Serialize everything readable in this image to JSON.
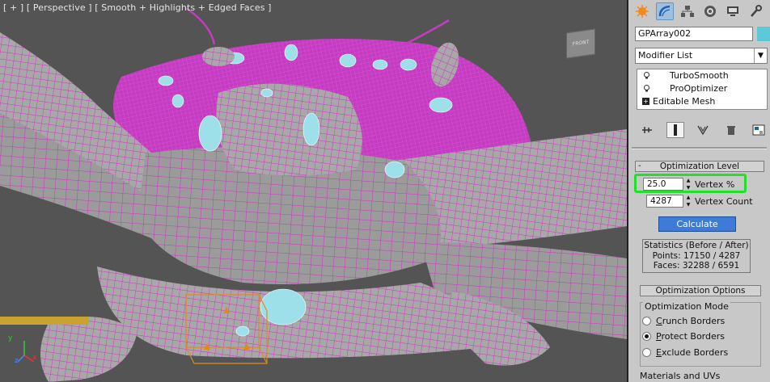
{
  "viewport": {
    "label": "[ + ] [ Perspective ] [ Smooth + Highlights + Edged Faces ]",
    "viewcube_label": "FRONT",
    "axis": {
      "x": "x",
      "y": "y",
      "z": "z"
    },
    "colors": {
      "wireframe": "#d92ad0",
      "mesh": "#9a9a9a",
      "background": "#545454",
      "selection_box": "#e08a1a",
      "ice": "#9ee0ea"
    }
  },
  "toolbar": {
    "tabs": [
      "create-icon",
      "modify-icon",
      "hierarchy-icon",
      "motion-icon",
      "display-icon",
      "utilities-icon"
    ]
  },
  "object": {
    "name": "GPArray002",
    "color": "#5dc9d8"
  },
  "modifier_list": {
    "label": "Modifier List"
  },
  "stack": {
    "items": [
      {
        "label": "TurboSmooth"
      },
      {
        "label": "ProOptimizer"
      },
      {
        "label": "Editable Mesh"
      }
    ]
  },
  "optimization_level": {
    "title": "Optimization Level",
    "vertex_percent_value": "25.0",
    "vertex_percent_label": "Vertex %",
    "vertex_count_value": "4287",
    "vertex_count_label": "Vertex Count",
    "calculate_label": "Calculate",
    "stats_title": "Statistics (Before / After)",
    "stats_points": "Points: 17150 / 4287",
    "stats_faces": "Faces: 32288 / 6591"
  },
  "optimization_options": {
    "title": "Optimization Options",
    "mode_label": "Optimization Mode",
    "modes": [
      {
        "first": "C",
        "rest": "runch Borders",
        "selected": false
      },
      {
        "first": "P",
        "rest": "rotect Borders",
        "selected": true
      },
      {
        "first": "E",
        "rest": "xclude Borders",
        "selected": false
      }
    ]
  },
  "materials": {
    "title": "Materials and UVs"
  },
  "accent": {
    "highlight": "#22e02a",
    "button": "#3e7bd6"
  }
}
